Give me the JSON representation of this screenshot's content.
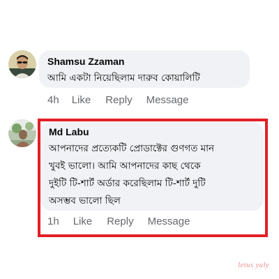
{
  "comments": [
    {
      "author": "Shamsu Zzaman",
      "text_lines": [
        "আমি একটা নিয়েছিলাম দারুব কোয়ালিটি"
      ],
      "time": "4h",
      "like_label": "Like",
      "reply_label": "Reply",
      "message_label": "Message"
    },
    {
      "author": "Md Labu",
      "text_lines": [
        "আপনাদের প্রত্যেকটি প্রোডাক্টের গুণগত মান",
        "খুবই ভালো। আমি আপনাদের কাছ থেকে",
        "দুইটি টি-শার্ট অর্ডার করেছিলাম টি-শার্ট দুটি",
        "অসম্ভব ভালো ছিল"
      ],
      "time": "1h",
      "like_label": "Like",
      "reply_label": "Reply",
      "message_label": "Message"
    }
  ],
  "watermark": "letus yaly",
  "colors": {
    "highlight": "#e21f26",
    "bubble": "#f0f2f5",
    "secondary_text": "#65676b"
  },
  "icons": {
    "avatar_1": "profile-photo-man-sunglasses",
    "avatar_2": "profile-photo-outdoor"
  }
}
